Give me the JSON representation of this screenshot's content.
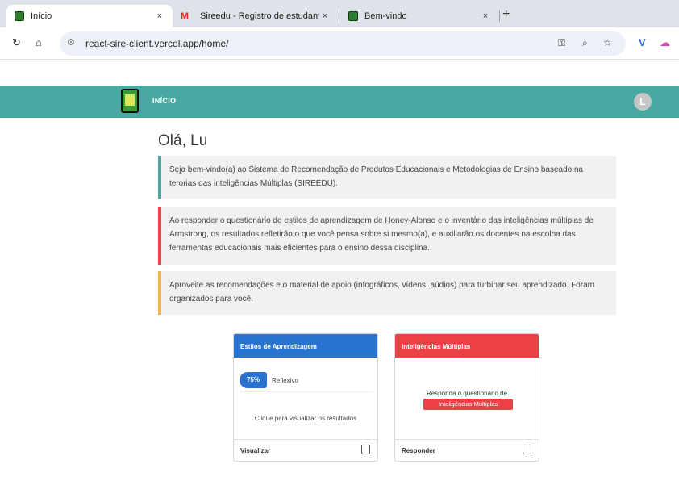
{
  "browser": {
    "tabs": [
      {
        "title": "Início",
        "close": "×"
      },
      {
        "title": "Sireedu - Registro de estudante",
        "close": "×"
      },
      {
        "title": "Bem-vindo",
        "close": "×"
      }
    ],
    "new_tab": "+",
    "url": "react-sire-client.vercel.app/home/",
    "icons": [
      "reload-icon",
      "home-icon",
      "site-settings-icon",
      "password-key-icon",
      "zoom-icon",
      "bookmark-star-icon",
      "extension-v-icon",
      "extension-cloud-icon"
    ]
  },
  "app": {
    "nav": {
      "inicio": "INÍCIO"
    },
    "avatar_letter": "L",
    "greeting": "Olá, Lu",
    "notices": {
      "welcome": "Seja bem-vindo(a) ao Sistema de Recomendação de Produtos Educacionais e Metodologias de Ensino baseado na terorias das inteligências Múltiplas (SIREEDU).",
      "questionnaire": "Ao responder o questionário de estilos de aprendizagem de Honey-Alonso e o inventário das inteligências múltiplas de Armstrong, os resultados refletirão o que você pensa sobre si mesmo(a), e auxiliarão os docentes na escolha das ferramentas educacionais mais eficientes para o ensino dessa disciplina.",
      "enjoy": "Aproveite as recomendações e o material de apoio (infográficos, vídeos, aúdios) para turbinar seu aprendizado. Foram organizados para você."
    },
    "cards": {
      "styles": {
        "header": "Estilos de Aprendizagem",
        "percent": "75%",
        "style": "Reflexivo",
        "hint": "Clique para visualizar os resultados",
        "footer": "Visualizar"
      },
      "intelligences": {
        "header": "Inteligências Múltiplas",
        "prompt": "Responda o questionário de",
        "tag": "Inteligências Múltiplas",
        "footer": "Responder"
      }
    }
  },
  "colors": {
    "teal": "#4aa8a3",
    "blue": "#2a72d0",
    "red": "#ed4147",
    "yellow": "#f2b441"
  }
}
